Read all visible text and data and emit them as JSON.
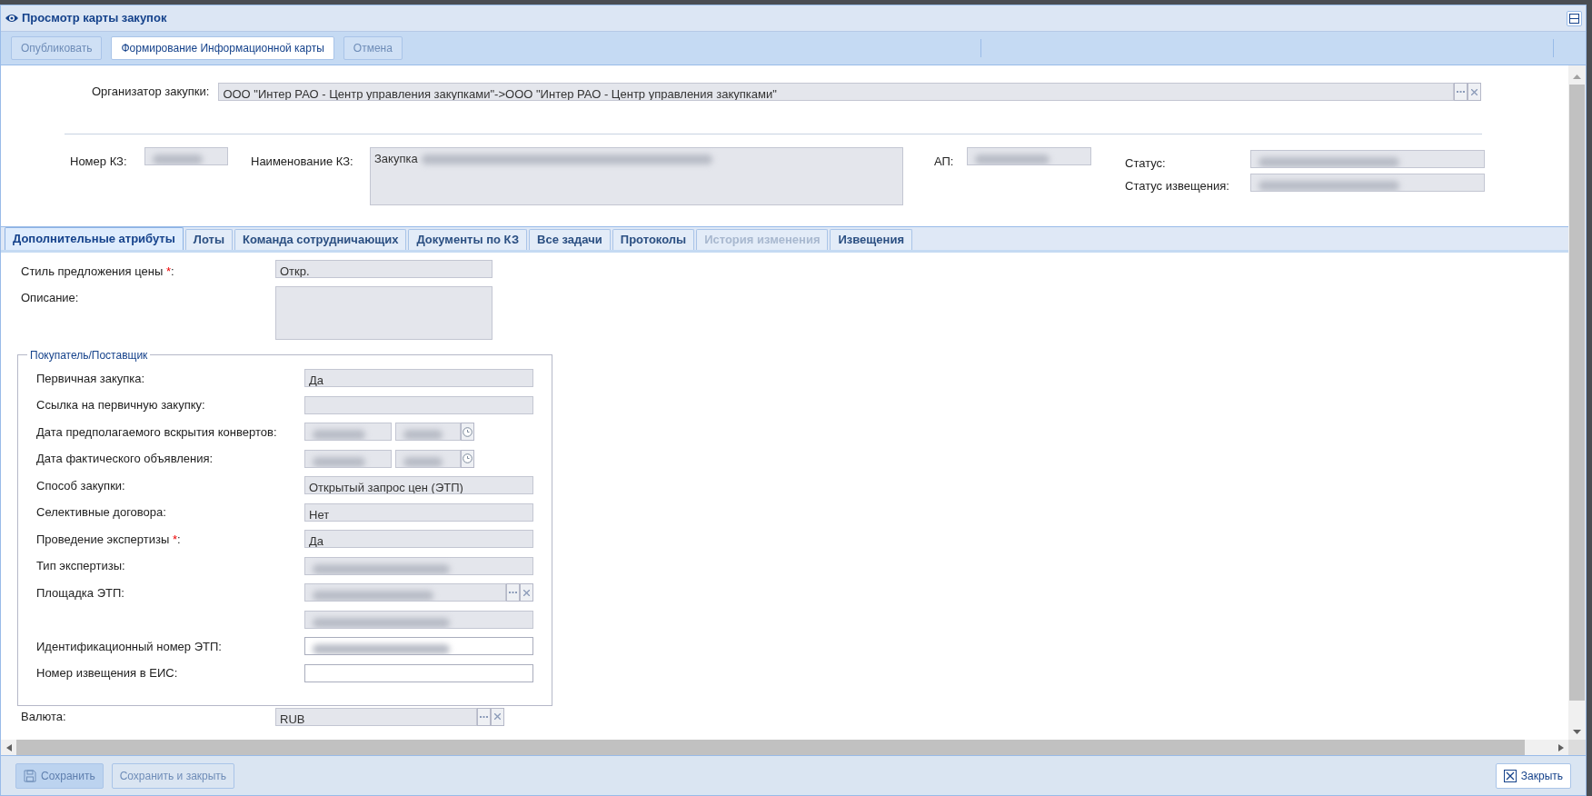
{
  "window": {
    "title": "Просмотр карты закупок"
  },
  "toolbar": [
    {
      "label": "Опубликовать",
      "disabled": true
    },
    {
      "label": "Формирование Информационной карты",
      "disabled": false
    },
    {
      "label": "Отмена",
      "disabled": true
    }
  ],
  "organizer": {
    "label": "Организатор закупки:",
    "value": "ООО \"Интер РАО - Центр управления закупками\"->ООО \"Интер РАО - Центр управления закупками\""
  },
  "header_fields": [
    {
      "label": "Номер КЗ:",
      "redacted": true
    },
    {
      "label": "Наименование КЗ:",
      "value": "Закупка",
      "redacted": true
    },
    {
      "label": "АП:",
      "redacted": true
    },
    {
      "label": "Статус:",
      "redacted": true
    },
    {
      "label": "Статус извещения:",
      "redacted": true
    }
  ],
  "tabs": [
    {
      "label": "Дополнительные атрибуты",
      "selected": true,
      "disabled": false
    },
    {
      "label": "Лоты",
      "selected": false,
      "disabled": false
    },
    {
      "label": "Команда сотрудничающих",
      "selected": false,
      "disabled": false
    },
    {
      "label": "Документы по КЗ",
      "selected": false,
      "disabled": false
    },
    {
      "label": "Все задачи",
      "selected": false,
      "disabled": false
    },
    {
      "label": "Протоколы",
      "selected": false,
      "disabled": false
    },
    {
      "label": "История изменения",
      "selected": false,
      "disabled": true
    },
    {
      "label": "Извещения",
      "selected": false,
      "disabled": false
    }
  ],
  "form": {
    "fields": [
      {
        "label": "Стиль предложения цены *:",
        "kind": "text",
        "value": "Откр.",
        "readonly": true
      },
      {
        "label": "Описание:",
        "kind": "textarea",
        "readonly": true
      }
    ],
    "group": {
      "legend": "Покупатель/Поставщик",
      "rows": [
        {
          "label": "Первичная закупка:",
          "kind": "text",
          "value": "Да",
          "readonly": true
        },
        {
          "label": "Ссылка на первичную закупку:",
          "kind": "text",
          "readonly": true
        },
        {
          "label": "Дата предполагаемого вскрытия конвертов:",
          "kind": "datetime",
          "redacted": true,
          "readonly": true
        },
        {
          "label": "Дата фактического объявления:",
          "kind": "datetime",
          "redacted": true,
          "readonly": true
        },
        {
          "label": "Способ закупки:",
          "kind": "text",
          "value": "Открытый запрос цен (ЭТП)",
          "readonly": true
        },
        {
          "label": "Селективные договора:",
          "kind": "text",
          "value": "Нет",
          "readonly": true
        },
        {
          "label": "Проведение экспертизы *:",
          "kind": "text",
          "value": "Да",
          "readonly": true
        },
        {
          "label": "Тип экспертизы:",
          "kind": "text",
          "redacted": true,
          "readonly": true
        },
        {
          "label": "Площадка ЭТП:",
          "kind": "lookup",
          "redacted": true,
          "readonly": true
        },
        {
          "kind": "text",
          "redacted": true,
          "readonly": true
        },
        {
          "label": "Идентификационный номер ЭТП:",
          "kind": "text",
          "redacted": true,
          "readonly": false
        },
        {
          "label": "Номер извещения в ЕИС:",
          "kind": "text",
          "readonly": false
        }
      ]
    },
    "currency": {
      "label": "Валюта:",
      "kind": "lookup",
      "value": "RUB",
      "readonly": true
    }
  },
  "footer": {
    "left": [
      {
        "label": "Сохранить",
        "disabled": true
      },
      {
        "label": "Сохранить и закрыть",
        "disabled": true
      }
    ],
    "right": [
      {
        "label": "Закрыть",
        "disabled": false
      }
    ]
  }
}
